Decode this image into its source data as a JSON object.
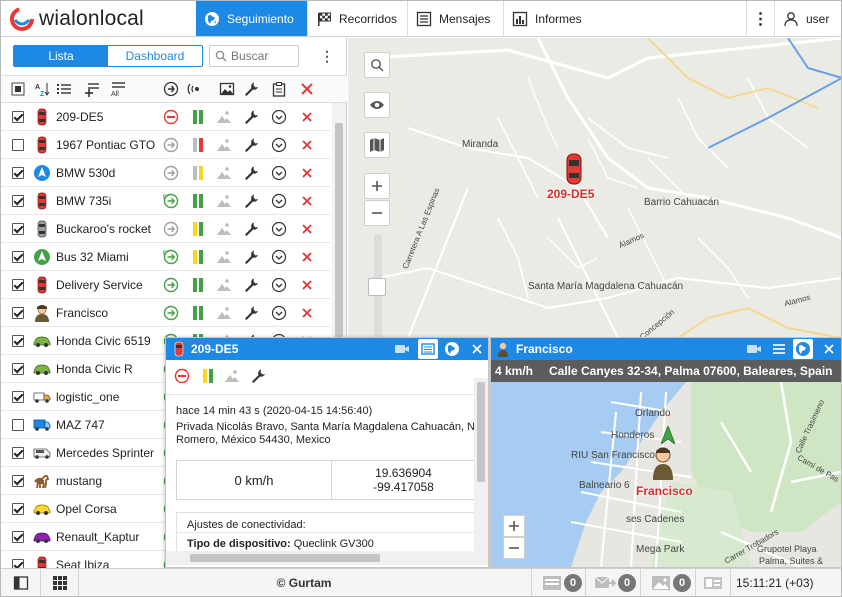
{
  "app": {
    "logo_text": "wialonlocal"
  },
  "nav": {
    "seguimiento": "Seguimiento",
    "recorridos": "Recorridos",
    "mensajes": "Mensajes",
    "informes": "Informes",
    "more": "⋮",
    "user": "user"
  },
  "left": {
    "tab_lista": "Lista",
    "tab_dashboard": "Dashboard",
    "search_placeholder": "Buscar",
    "more": "⋮"
  },
  "units": [
    {
      "name": "209-DE5",
      "checked": true,
      "icon": "red-car-icon",
      "state": "stop"
    },
    {
      "name": "1967 Pontiac GTO",
      "checked": false,
      "icon": "red-car-icon",
      "state": "arrow-gray"
    },
    {
      "name": "BMW 530d",
      "checked": true,
      "icon": "blue-arrow-icon",
      "state": "arrow-gray"
    },
    {
      "name": "BMW 735i",
      "checked": true,
      "icon": "red-car-icon",
      "state": "arrow-green-p"
    },
    {
      "name": "Buckaroo's rocket",
      "checked": true,
      "icon": "gray-car-icon",
      "state": "arrow-gray"
    },
    {
      "name": "Bus 32 Miami",
      "checked": true,
      "icon": "green-arrow-icon",
      "state": "arrow-green-p"
    },
    {
      "name": "Delivery Service",
      "checked": true,
      "icon": "red-car-icon",
      "state": "arrow-green"
    },
    {
      "name": "Francisco",
      "checked": true,
      "icon": "person-icon",
      "state": "arrow-green"
    },
    {
      "name": "Honda Civic 6519",
      "checked": true,
      "icon": "green-car-icon",
      "state": "arrow-green"
    },
    {
      "name": "Honda Civic R",
      "checked": true,
      "icon": "green-car-icon",
      "state": "arrow-green"
    },
    {
      "name": "logistic_one",
      "checked": true,
      "icon": "truck-icon",
      "state": "arrow-green"
    },
    {
      "name": "MAZ 747",
      "checked": false,
      "icon": "blue-truck-icon",
      "state": "arrow-green"
    },
    {
      "name": "Mercedes Sprinter",
      "checked": true,
      "icon": "van-icon",
      "state": "arrow-green"
    },
    {
      "name": "mustang",
      "checked": true,
      "icon": "horse-icon",
      "state": "arrow-green"
    },
    {
      "name": "Opel Corsa",
      "checked": true,
      "icon": "yellow-car-icon",
      "state": "arrow-green"
    },
    {
      "name": "Renault_Kaptur",
      "checked": true,
      "icon": "purple-car-icon",
      "state": "arrow-green"
    },
    {
      "name": "Seat Ibiza",
      "checked": true,
      "icon": "red-car-icon",
      "state": "arrow-green"
    }
  ],
  "map": {
    "labels": {
      "miranda": "Miranda",
      "barrio": "Barrio Cahuacán",
      "santa_maria": "Santa María Magdalena Cahuacán",
      "carretera": "Carretera A Las Espinas",
      "alamos": "Álamos",
      "alamos2": "Alamos",
      "concepcion": "Concepción"
    },
    "unit_label": "209-DE5"
  },
  "popup1": {
    "title": "209-DE5",
    "time": "hace 14 min 43 s (2020-04-15 14:56:40)",
    "address": "Privada Nicolás Bravo, Santa María Magdalena Cahuacán, N Romero, México 54430, Mexico",
    "speed": "0 km/h",
    "lat": "19.636904",
    "lon": "-99.417058",
    "conn_title": "Ajustes de conectividad:",
    "device_label": "Tipo de dispositivo:",
    "device_value": "Queclink GV300"
  },
  "popup2": {
    "title": "Francisco",
    "speed": "4 km/h",
    "address": "Calle Canyes 32-34, Palma 07600, Baleares, Spain",
    "unit_label": "Francisco",
    "labels": {
      "orlando": "Orlando",
      "honderos": "Honderos",
      "riu": "RIU San Francisco",
      "balneario": "Balneario 6",
      "cadenes": "ses Cadenes",
      "megapark": "Mega Park",
      "trobadors": "Carrer Trobadors",
      "grupotel": "Grupotel Playa",
      "palma": "Palma, Suites &",
      "cami": "Camí de Pas",
      "trasimeno": "Calle Trasimeno"
    }
  },
  "bottom": {
    "copyright": "© Gurtam",
    "count1": "0",
    "count2": "0",
    "count3": "0",
    "clock": "15:11:21 (+03)"
  }
}
